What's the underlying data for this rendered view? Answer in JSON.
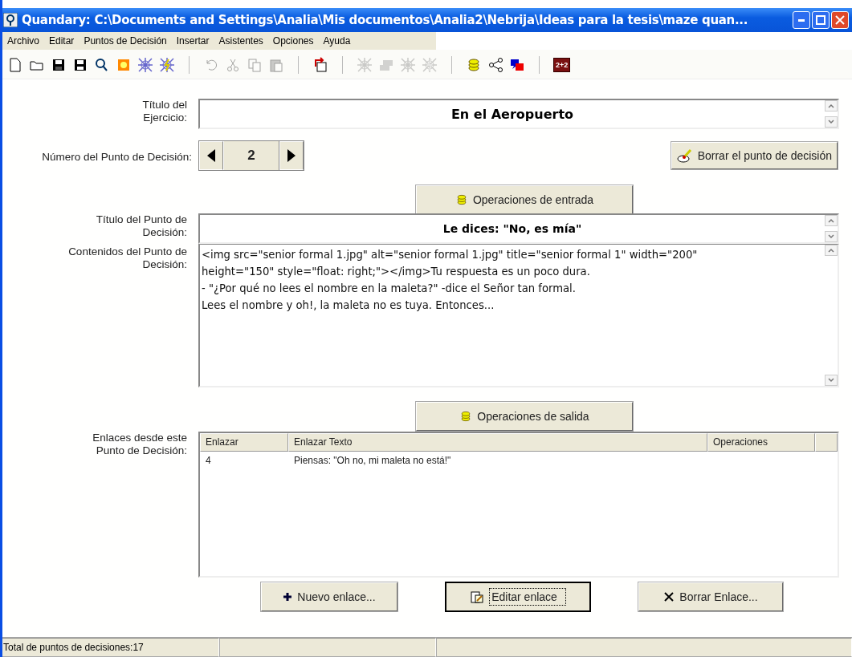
{
  "window": {
    "title": "Quandary: C:\\Documents and Settings\\Analia\\Mis documentos\\Analia2\\Nebrija\\Ideas para la tesis\\maze quan..."
  },
  "menu": [
    "Archivo",
    "Editar",
    "Puntos de Decisión",
    "Insertar",
    "Asistentes",
    "Opciones",
    "Ayuda"
  ],
  "toolbar": [
    [
      {
        "kind": "new",
        "disabled": false
      },
      {
        "kind": "open",
        "disabled": false
      },
      {
        "kind": "save",
        "disabled": false
      },
      {
        "kind": "save-as",
        "disabled": false
      },
      {
        "kind": "find",
        "disabled": false
      },
      {
        "kind": "sun",
        "disabled": false
      },
      {
        "kind": "web",
        "disabled": false
      },
      {
        "kind": "web-bolt",
        "disabled": false
      }
    ],
    [
      {
        "kind": "undo",
        "disabled": true
      },
      {
        "kind": "cut",
        "disabled": true
      },
      {
        "kind": "copy",
        "disabled": true
      },
      {
        "kind": "paste",
        "disabled": true
      }
    ],
    [
      {
        "kind": "redo-doc",
        "disabled": false
      }
    ],
    [
      {
        "kind": "web",
        "disabled": true
      },
      {
        "kind": "stack",
        "disabled": true
      },
      {
        "kind": "web",
        "disabled": true
      },
      {
        "kind": "web-bolt",
        "disabled": true
      }
    ],
    [
      {
        "kind": "coins",
        "disabled": false
      },
      {
        "kind": "share",
        "disabled": false
      },
      {
        "kind": "chat",
        "disabled": false
      }
    ],
    [
      {
        "kind": "sum",
        "label": "2+2",
        "disabled": false
      }
    ]
  ],
  "exercise_title": {
    "label": "Título del Ejercicio:",
    "value": "En el Aeropuerto"
  },
  "point_number": {
    "label": "Número del Punto de Decisión:",
    "value": "2"
  },
  "delete_point_button": "Borrar el punto de decisión",
  "input_operations_button": "Operaciones de entrada",
  "point_title": {
    "label": "Título del Punto de Decisión:",
    "value": "Le dices: \"No, es mía\""
  },
  "point_content": {
    "label": "Contenidos del Punto de Decisión:",
    "lines": [
      "<img src=\"senior formal 1.jpg\" alt=\"senior formal 1.jpg\" title=\"senior formal 1\" width=\"200\"",
      "height=\"150\" style=\"float: right;\"></img>Tu respuesta es un poco dura.",
      "- \"¿Por qué no lees el nombre en la maleta?\" -dice el Señor tan formal.",
      "Lees el nombre y oh!, la maleta no es tuya. Entonces..."
    ]
  },
  "output_operations_button": "Operaciones de salida",
  "links": {
    "label": "Enlaces desde este Punto de Decisión:",
    "columns": [
      "Enlazar",
      "Enlazar Texto",
      "Operaciones"
    ],
    "rows": [
      [
        "4",
        "Piensas: \"Oh no, mi maleta no está!\"",
        ""
      ]
    ]
  },
  "buttons": [
    {
      "kind": "new",
      "label": "Nuevo enlace...",
      "selected": false
    },
    {
      "kind": "edit",
      "label": "Editar enlace",
      "selected": true
    },
    {
      "kind": "delete",
      "label": "Borrar Enlace..."
    }
  ],
  "status_bar": [
    "Total de puntos de decisiones:17"
  ]
}
